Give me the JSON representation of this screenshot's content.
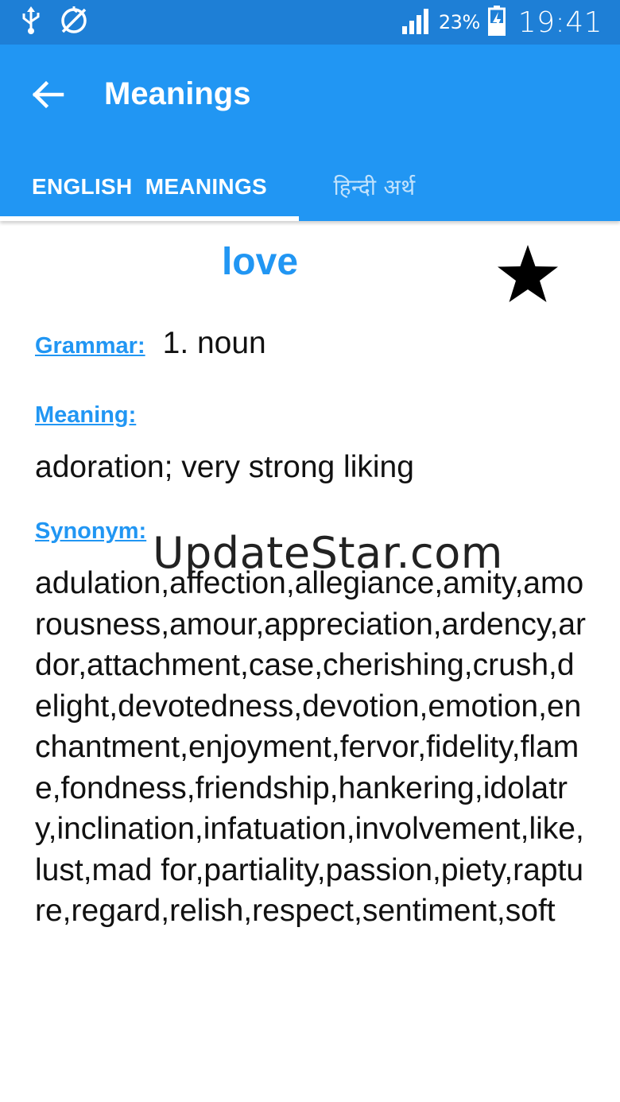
{
  "status_bar": {
    "icons": [
      "usb-icon",
      "no-sync-icon",
      "signal-icon",
      "battery-charging-icon"
    ],
    "battery_percent": "23%",
    "time": "19:41"
  },
  "app_bar": {
    "title": "Meanings",
    "back_icon": "arrow-back-icon"
  },
  "tabs": [
    {
      "label": "ENGLISH  MEANINGS",
      "selected": true
    },
    {
      "label": "हिन्दी अर्थ",
      "selected": false
    }
  ],
  "entry": {
    "word": "love",
    "favorite_icon": "star-icon",
    "grammar_label": "Grammar:",
    "grammar_value": "1. noun",
    "meaning_label": "Meaning:",
    "meaning_value": "adoration; very strong liking",
    "synonym_label": "Synonym:",
    "synonym_value": "adulation,affection,allegiance,amity,amorousness,amour,appreciation,ardency,ardor,attachment,case,cherishing,crush,delight,devotedness,devotion,emotion,enchantment,enjoyment,fervor,fidelity,flame,fondness,friendship,hankering,idolatry,inclination,infatuation,involvement,like,lust,mad for,partiality,passion,piety,rapture,regard,relish,respect,sentiment,soft"
  },
  "watermark": "UpdateStar.com",
  "colors": {
    "status_bar": "#1e7fd6",
    "app_bar": "#2196f3",
    "accent": "#2196f3",
    "text": "#111111"
  }
}
